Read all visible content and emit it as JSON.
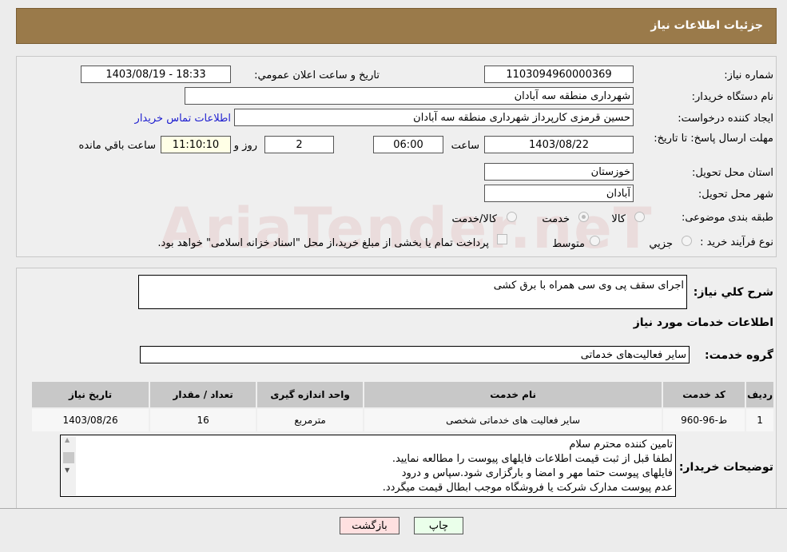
{
  "header": {
    "title": "جزئیات اطلاعات نیاز"
  },
  "fields": {
    "need_number_label": "شماره نیاز:",
    "need_number": "1103094960000369",
    "announce_label": "تاریخ و ساعت اعلان عمومي:",
    "announce_value": "1403/08/19 - 18:33",
    "buyer_org_label": "نام دستگاه خریدار:",
    "buyer_org": "شهرداری منطقه سه آبادان",
    "creator_label": "ایجاد کننده درخواست:",
    "creator": "حسین قرمزی کارپرداز شهرداری منطقه سه آبادان",
    "contact_link": "اطلاعات تماس خریدار",
    "deadline_label": "مهلت ارسال پاسخ: تا تاریخ:",
    "deadline_date": "1403/08/22",
    "time_label": "ساعت",
    "deadline_time": "06:00",
    "days": "2",
    "days_label": "روز و",
    "remaining": "11:10:10",
    "remaining_label": "ساعت باقي مانده",
    "province_label": "استان محل تحویل:",
    "province": "خوزستان",
    "city_label": "شهر محل تحویل:",
    "city": "آبادان",
    "category_label": "طبقه بندی موضوعی:",
    "category_options": [
      "کالا",
      "خدمت",
      "کالا/خدمت"
    ],
    "category_selected": "خدمت",
    "process_label": "نوع فرآیند خرید :",
    "process_options": [
      "جزیي",
      "متوسط"
    ],
    "process_note": "پرداخت تمام یا بخشی از مبلغ خرید،از محل \"اسناد خزانه اسلامی\" خواهد بود."
  },
  "watermark": "AriaTender.neT",
  "summary": {
    "label": "شرح کلي نیاز:",
    "value": "اجرای سقف پی وی سی همراه با برق کشی"
  },
  "services": {
    "title": "اطلاعات خدمات مورد نیاز",
    "group_label": "گروه خدمت:",
    "group_value": "سایر فعالیت‌های خدماتی",
    "columns": [
      "ردیف",
      "کد خدمت",
      "نام خدمت",
      "واحد اندازه گیری",
      "تعداد / مقدار",
      "تاریخ نیاز"
    ],
    "rows": [
      [
        "1",
        "ط-96-960",
        "سایر فعالیت های خدماتی شخصی",
        "مترمربع",
        "16",
        "1403/08/26"
      ]
    ]
  },
  "buyer_notes": {
    "label": "توضیحات خریدار:",
    "lines": [
      "تامین کننده محترم سلام",
      "لطفا قبل از ثبت قیمت اطلاعات فایلهای پیوست را مطالعه نمایید.",
      "فایلهای پیوست حتما مهر و امضا و بارگزاری شود.سپاس و درود",
      "عدم پیوست مدارک شرکت یا فروشگاه موجب ابطال قیمت میگردد."
    ]
  },
  "buttons": {
    "print": "چاپ",
    "back": "بازگشت"
  },
  "colors": {
    "header": "#9a7a4a",
    "print_bg": "#eaffea",
    "back_bg": "#ffe0e0",
    "link": "#2020d0"
  }
}
